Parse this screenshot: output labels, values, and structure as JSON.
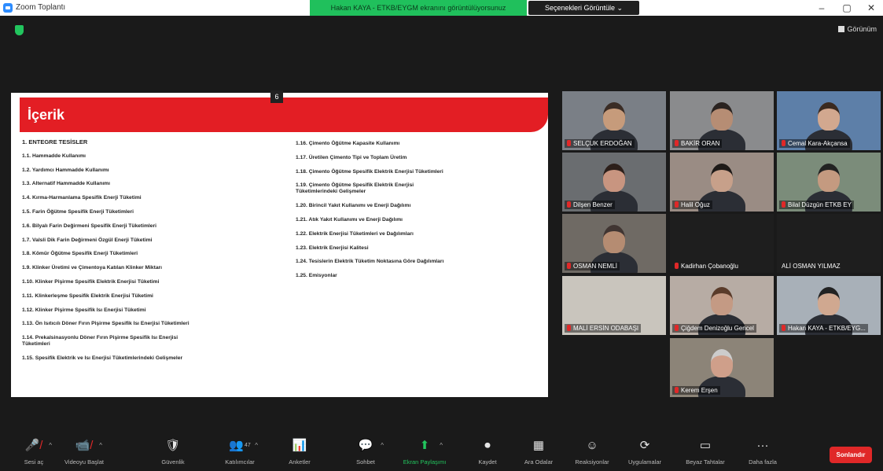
{
  "window": {
    "title": "Zoom Toplantı",
    "share_banner": "Hakan KAYA - ETKB/EYGM ekranını görüntülüyorsunuz",
    "view_options": "Seçenekleri Görüntüle ⌄",
    "controls": [
      "–",
      "▢",
      "✕"
    ]
  },
  "meeting": {
    "view_label": "Görünüm",
    "page_indicator": "6"
  },
  "slide": {
    "title": "İçerik",
    "left_column": [
      "1. ENTEGRE TESİSLER",
      "1.1. Hammadde Kullanımı",
      "1.2. Yardımcı Hammadde Kullanımı",
      "1.3. Alternatif Hammadde Kullanımı",
      "1.4. Kırma-Harmanlama Spesifik Enerji Tüketimi",
      "1.5. Farin Öğütme Spesifik Enerji Tüketimleri",
      "1.6. Bilyalı Farin Değirmeni Spesifik Enerji Tüketimleri",
      "1.7. Valsli Dik Farin Değirmeni Özgül Enerji Tüketimi",
      "1.8. Kömür Öğütme Spesifik Enerji Tüketimleri",
      "1.9. Klinker Üretimi ve Çimentoya Katılan Klinker Miktarı",
      "1.10. Klinker Pişirme Spesifik Elektrik Enerjisi Tüketimi",
      "1.11. Klinkerleşme Spesifik Elektrik Enerjisi Tüketimi",
      "1.12. Klinker Pişirme Spesifik Isı Enerjisi Tüketimi",
      "1.13. Ön Isıtıcılı Döner Fırın Pişirme Spesifik Isı Enerjisi Tüketimleri",
      "1.14. Prekalsinasyonlu Döner Fırın Pişirme Spesifik Isı Enerjisi\nTüketimleri",
      "1.15. Spesifik Elektrik ve Isı Enerjisi Tüketimlerindeki Gelişmeler"
    ],
    "right_column": [
      "1.16. Çimento Öğütme Kapasite Kullanımı",
      "1.17. Üretilen Çimento Tipi ve Toplam Üretim",
      "1.18. Çimento Öğütme Spesifik Elektrik Enerjisi Tüketimleri",
      "1.19. Çimento Öğütme Spesifik Elektrik Enerjisi\nTüketimlerindeki Gelişmeler",
      "1.20. Birincil Yakıt Kullanımı ve Enerji Dağılımı",
      "1.21. Atık Yakıt Kullanımı ve Enerji Dağılımı",
      "1.22. Elektrik Enerjisi Tüketimleri ve Dağılımları",
      "1.23. Elektrik Enerjisi Kalitesi",
      "1.24. Tesislerin Elektrik Tüketim Noktasına Göre Dağılımları",
      "1.25. Emisyonlar"
    ]
  },
  "participants": [
    {
      "name": "SELÇUK ERDOĞAN"
    },
    {
      "name": "BAKİR ORAN"
    },
    {
      "name": "Cemal Kara-Akçansa"
    },
    {
      "name": "Dilşen Benzer"
    },
    {
      "name": "Halil Oğuz"
    },
    {
      "name": "Bilal Düzgün ETKB EY"
    },
    {
      "name": "OSMAN NEMLİ"
    },
    {
      "name": "Kadirhan Çobanoğlu"
    },
    {
      "name": "ALİ OSMAN YILMAZ"
    },
    {
      "name": "MALİ ERSİN ODABAŞI"
    },
    {
      "name": "Çiğdem Denizoğlu Gencel"
    },
    {
      "name": "Hakan KAYA - ETKB/EYG..."
    },
    {
      "name": "Kerem Erşen"
    }
  ],
  "toolbar": {
    "mute": "Sesi aç",
    "video": "Videoyu Başlat",
    "security": "Güvenlik",
    "participants": "Katılımcılar",
    "participants_count": "47",
    "polls": "Anketler",
    "chat": "Sohbet",
    "share": "Ekran Paylaşımı",
    "record": "Kaydet",
    "breakout": "Ara Odalar",
    "reactions": "Reaksiyonlar",
    "apps": "Uygulamalar",
    "whiteboard": "Beyaz Tahtalar",
    "more": "Daha fazla",
    "end": "Sonlandır"
  },
  "colors": {
    "accent_green": "#22c55e",
    "slide_red": "#e31e24",
    "end_red": "#e02828",
    "active_speaker": "#c8e64a"
  }
}
